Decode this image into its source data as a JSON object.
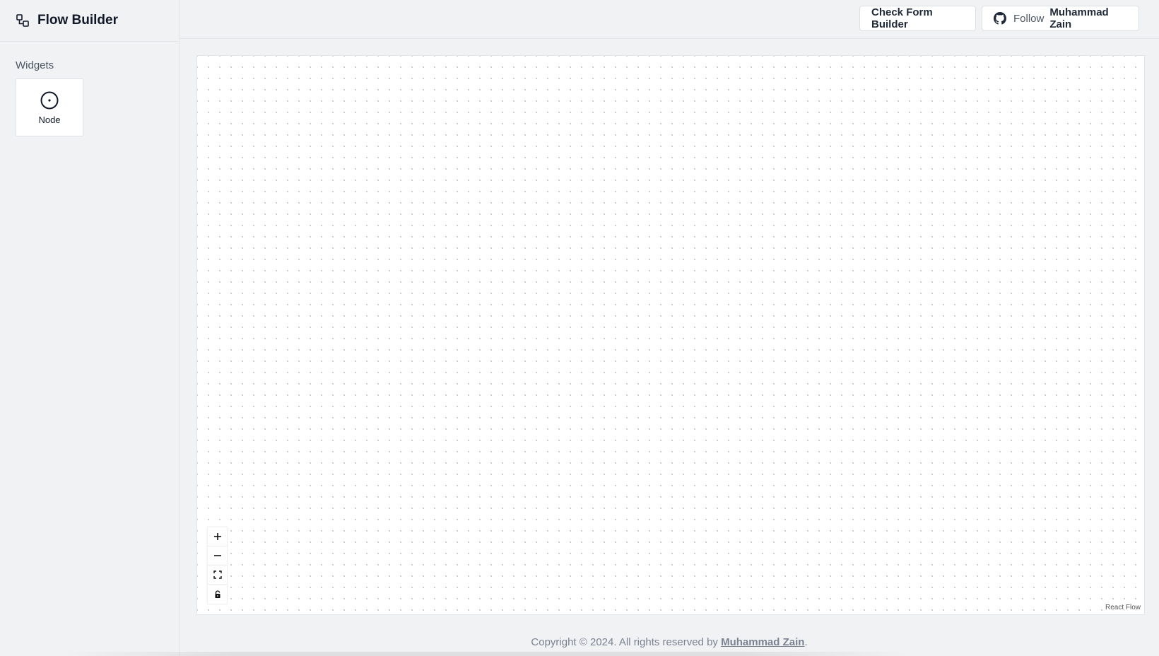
{
  "app": {
    "title": "Flow Builder"
  },
  "sidebar": {
    "section_label": "Widgets",
    "widgets": [
      {
        "label": "Node",
        "icon": "circle-dot-icon"
      }
    ]
  },
  "header": {
    "form_builder_button": "Check Form Builder",
    "follow_button": {
      "icon": "github-icon",
      "prefix": "Follow",
      "name": "Muhammad Zain"
    }
  },
  "canvas": {
    "controls": [
      {
        "name": "zoom-in",
        "icon": "plus-icon"
      },
      {
        "name": "zoom-out",
        "icon": "minus-icon"
      },
      {
        "name": "fit-view",
        "icon": "fit-view-icon"
      },
      {
        "name": "toggle-interactivity",
        "icon": "lock-icon"
      }
    ],
    "attribution": "React Flow"
  },
  "footer": {
    "copyright": "Copyright © 2024. All rights reserved by ",
    "author": "Muhammad Zain",
    "suffix": "."
  },
  "colors": {
    "background": "#f1f2f4",
    "canvas": "#ffffff",
    "dot": "#c3c7cd",
    "text_primary": "#111827",
    "footer_text": "#7a8291"
  }
}
